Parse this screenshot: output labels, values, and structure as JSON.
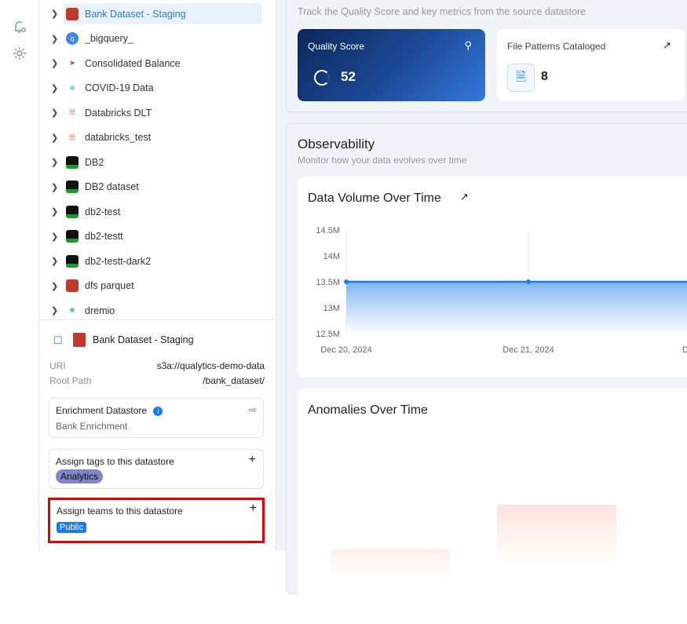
{
  "tree": {
    "items": [
      {
        "label": "Bank Dataset - Staging",
        "icon": "amazon-s3-icon",
        "selected": true
      },
      {
        "label": "_bigquery_",
        "icon": "bigquery-icon"
      },
      {
        "label": "Consolidated Balance",
        "icon": "oracle-icon"
      },
      {
        "label": "COVID-19 Data",
        "icon": "snowflake-icon"
      },
      {
        "label": "Databricks DLT",
        "icon": "databricks-icon"
      },
      {
        "label": "databricks_test",
        "icon": "databricks-icon"
      },
      {
        "label": "DB2",
        "icon": "ibm-db2-icon"
      },
      {
        "label": "DB2 dataset",
        "icon": "ibm-db2-icon"
      },
      {
        "label": "db2-test",
        "icon": "ibm-db2-icon"
      },
      {
        "label": "db2-testt",
        "icon": "ibm-db2-icon"
      },
      {
        "label": "db2-testt-dark2",
        "icon": "ibm-db2-icon"
      },
      {
        "label": "dfs parquet",
        "icon": "amazon-s3-icon"
      },
      {
        "label": "dremio",
        "icon": "dremio-icon"
      }
    ]
  },
  "detail": {
    "name": "Bank Dataset - Staging",
    "uri_label": "URI",
    "uri": "s3a://qualytics-demo-data",
    "root_label": "Root Path",
    "root": "/bank_dataset/",
    "enrichment_title": "Enrichment Datastore",
    "enrichment_value": "Bank Enrichment",
    "tags_title": "Assign tags to this datastore",
    "tag": "Analytics",
    "teams_title": "Assign teams to this datastore",
    "team": "Public"
  },
  "overview": {
    "subtitle": "Track the Quality Score and key metrics from the source datastore",
    "quality_label": "Quality Score",
    "quality_value": "52",
    "patterns_label": "File Patterns Cataloged",
    "patterns_value": "8"
  },
  "observability": {
    "title": "Observability",
    "subtitle": "Monitor how your data evolves over time",
    "volume_title": "Data Volume Over Time",
    "anomalies_title": "Anomalies Over Time"
  },
  "chart_data": {
    "type": "area",
    "title": "Data Volume Over Time",
    "x": [
      "Dec 20, 2024",
      "Dec 21, 2024"
    ],
    "y": [
      13.5,
      13.5
    ],
    "yticks": [
      "14.5M",
      "14M",
      "13.5M",
      "13M",
      "12.5M"
    ],
    "ylim": [
      12.5,
      14.5
    ],
    "color": "#1a7cf0"
  },
  "colors": {
    "accent": "#2d7ae5",
    "highlight": "#e60000"
  }
}
